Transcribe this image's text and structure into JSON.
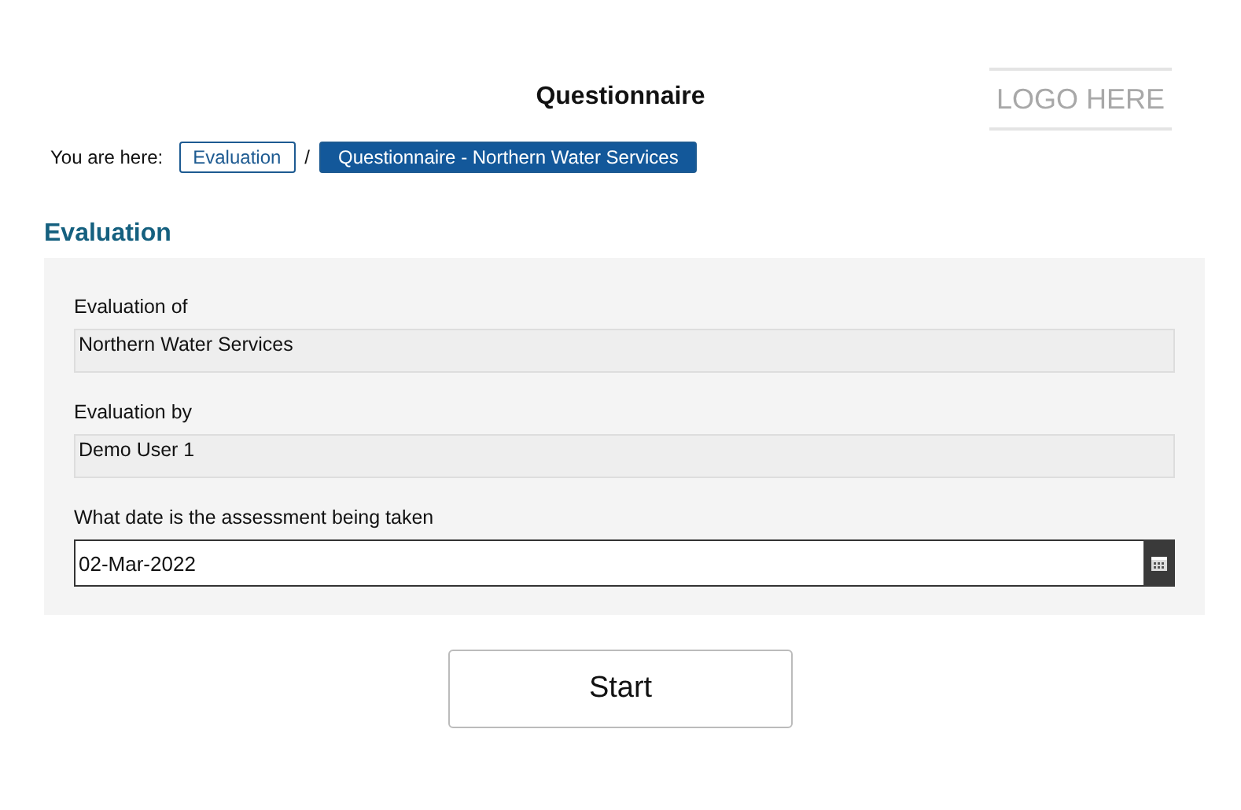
{
  "header": {
    "title": "Questionnaire",
    "logo": "LOGO HERE"
  },
  "breadcrumb": {
    "label": "You are here:",
    "separator": "/",
    "items": [
      {
        "label": "Evaluation",
        "selected": false
      },
      {
        "label": "Questionnaire - Northern Water Services",
        "selected": true
      }
    ]
  },
  "section": {
    "title": "Evaluation",
    "fields": [
      {
        "kind": "readonly",
        "label": "Evaluation of",
        "value": "Northern Water Services"
      },
      {
        "kind": "readonly",
        "label": "Evaluation by",
        "value": "Demo User 1"
      },
      {
        "kind": "date",
        "label": "What date is the assessment being taken",
        "value": "02-Mar-2022"
      }
    ]
  },
  "buttons": [
    "Start"
  ]
}
